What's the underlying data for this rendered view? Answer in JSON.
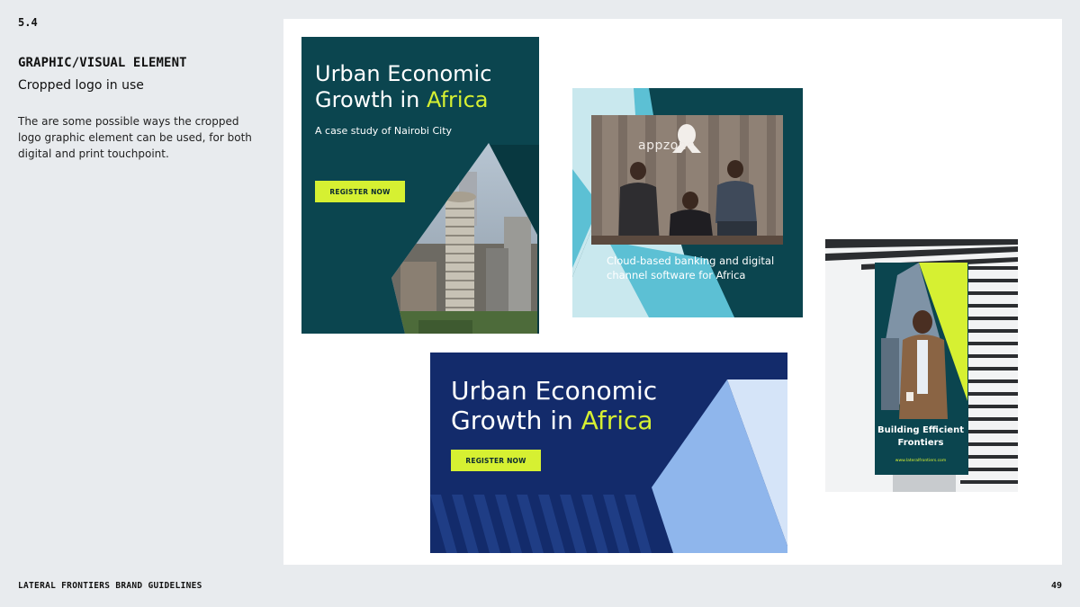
{
  "page": {
    "section_number": "5.4",
    "heading": "GRAPHIC/VISUAL ELEMENT",
    "subheading": "Cropped logo in use",
    "body": "The are some possible ways the cropped logo graphic element can be used, for both digital and print touchpoint.",
    "footer_left": "LATERAL FRONTIERS BRAND GUIDELINES",
    "page_number": "49"
  },
  "card1": {
    "title_part1": "Urban Economic Growth in ",
    "title_accent": "Africa",
    "subtitle": "A case study of Nairobi City",
    "button": "REGISTER NOW"
  },
  "card2": {
    "logo_word": "appzone",
    "caption": "Cloud-based banking and digital channel software for Africa"
  },
  "card3": {
    "title_part1": "Urban Economic Growth in ",
    "title_accent": "Africa",
    "button": "REGISTER NOW"
  },
  "card4": {
    "banner_title": "Building Efficient Frontiers",
    "banner_url": "www.lateralfrontiers.com"
  },
  "colors": {
    "teal": "#0b454f",
    "lime": "#d6f032",
    "navy": "#132b6b",
    "light_blue": "#8fb6ec",
    "pale_blue": "#d5e4f8",
    "cyan": "#5cc0d4"
  }
}
